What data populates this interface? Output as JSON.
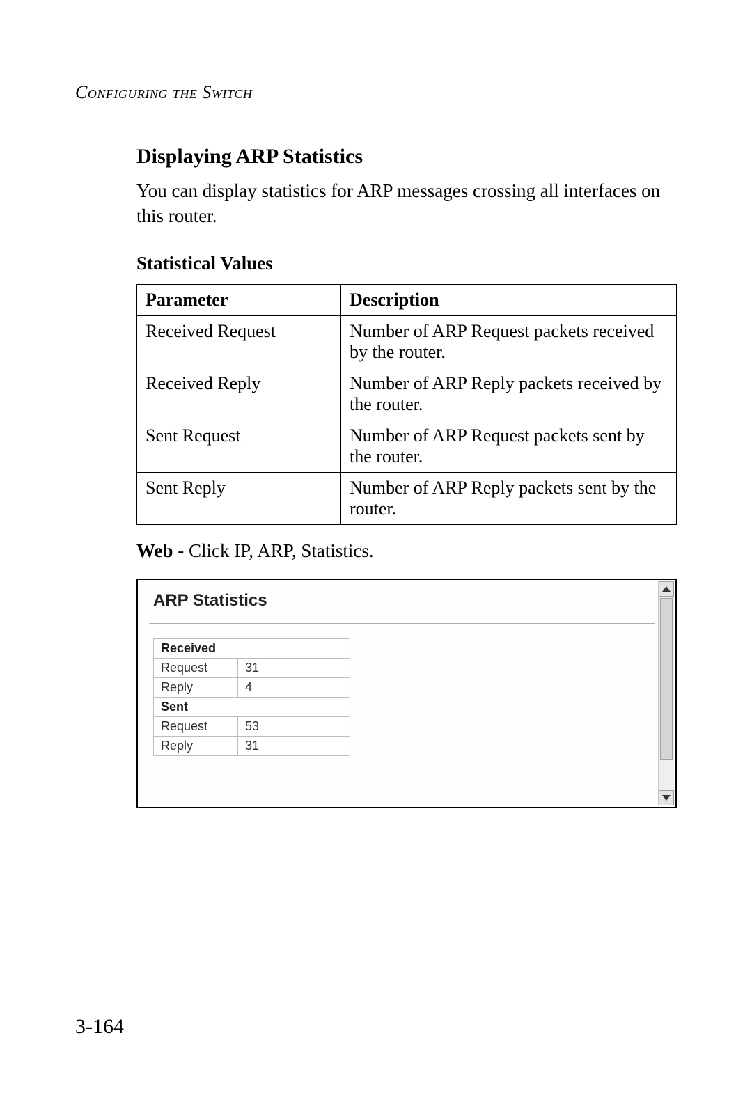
{
  "running_head": "Configuring the Switch",
  "section_title": "Displaying ARP Statistics",
  "intro_para": "You can display statistics for ARP messages crossing all interfaces on this router.",
  "stat_values_heading": "Statistical Values",
  "param_table": {
    "headers": {
      "param": "Parameter",
      "desc": "Description"
    },
    "rows": [
      {
        "param": "Received Request",
        "desc": "Number of ARP Request packets received by the router."
      },
      {
        "param": "Received Reply",
        "desc": "Number of ARP Reply packets received by the router."
      },
      {
        "param": "Sent Request",
        "desc": "Number of ARP Request packets sent by the router."
      },
      {
        "param": "Sent Reply",
        "desc": "Number of ARP Reply packets sent by the router."
      }
    ]
  },
  "web_line": {
    "lead": "Web - ",
    "rest": "Click IP, ARP, Statistics."
  },
  "screenshot": {
    "title": "ARP Statistics",
    "groups": [
      {
        "name": "Received",
        "rows": [
          {
            "label": "Request",
            "value": "31"
          },
          {
            "label": "Reply",
            "value": "4"
          }
        ]
      },
      {
        "name": "Sent",
        "rows": [
          {
            "label": "Request",
            "value": "53"
          },
          {
            "label": "Reply",
            "value": "31"
          }
        ]
      }
    ]
  },
  "page_number": "3-164"
}
